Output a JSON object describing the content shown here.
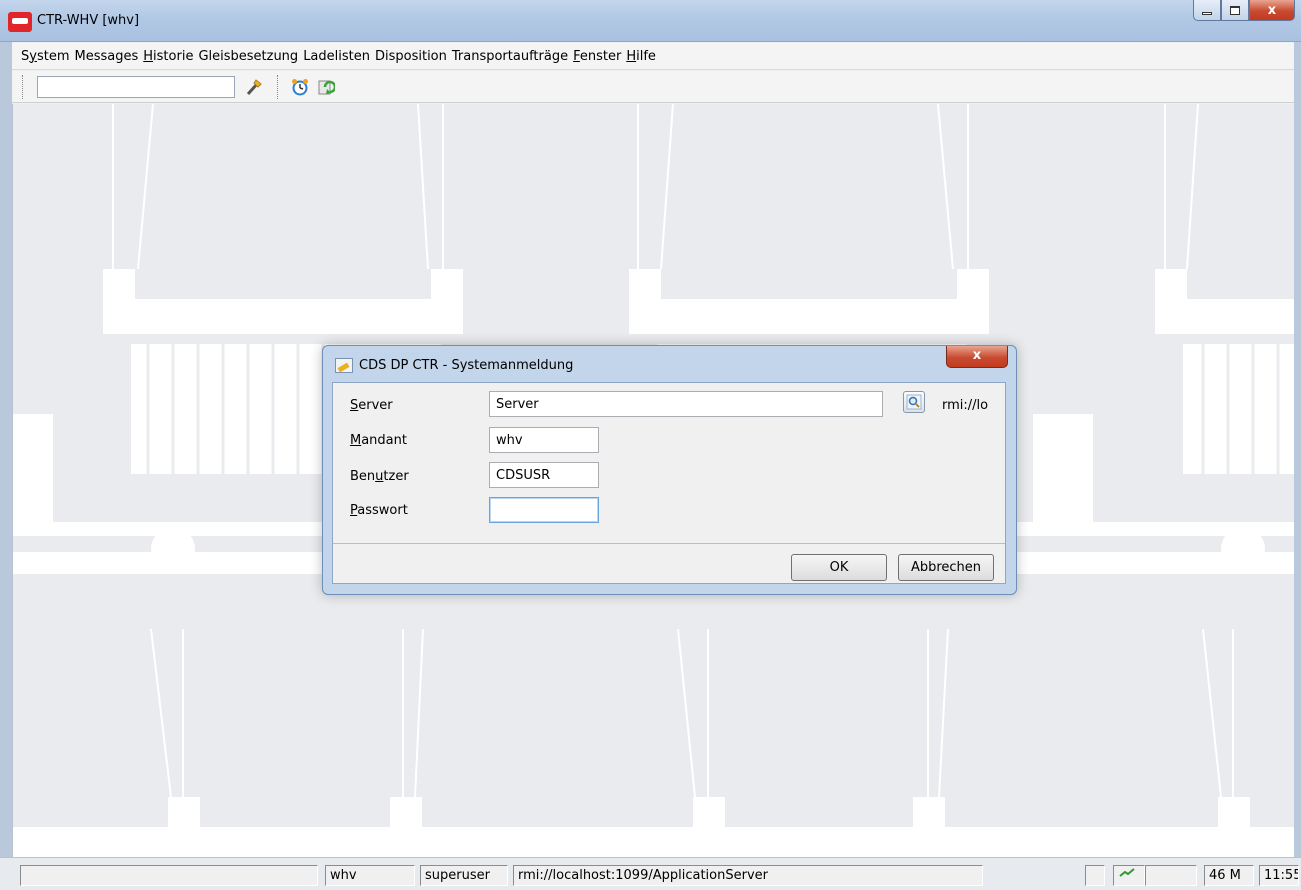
{
  "window": {
    "title": "CTR-WHV  [whv]",
    "close_glyph": "x"
  },
  "menu": {
    "items": [
      {
        "pre": "S",
        "ul": "y",
        "post": "stem"
      },
      {
        "pre": "Messages",
        "ul": "",
        "post": ""
      },
      {
        "pre": "",
        "ul": "H",
        "post": "istorie"
      },
      {
        "pre": "Gleisbesetzung",
        "ul": "",
        "post": ""
      },
      {
        "pre": "Ladelisten",
        "ul": "",
        "post": ""
      },
      {
        "pre": "Disposition",
        "ul": "",
        "post": ""
      },
      {
        "pre": "Transportaufträge",
        "ul": "",
        "post": ""
      },
      {
        "pre": "",
        "ul": "F",
        "post": "enster"
      },
      {
        "pre": "",
        "ul": "H",
        "post": "ilfe"
      }
    ]
  },
  "toolbar": {
    "search_value": "",
    "icons": [
      "wand-icon",
      "alarm-clock-icon",
      "refresh-icon"
    ]
  },
  "dialog": {
    "title": "CDS DP CTR - Systemanmeldung",
    "close_glyph": "x",
    "fields": {
      "server": {
        "label_ul": "S",
        "label_rest": "erver",
        "value": "Server"
      },
      "mandant": {
        "label_ul": "M",
        "label_rest": "andant",
        "value": "whv"
      },
      "benutzer": {
        "label_pre": "Ben",
        "label_ul": "u",
        "label_rest": "tzer",
        "value": "CDSUSR"
      },
      "passwort": {
        "label_ul": "P",
        "label_rest": "asswort",
        "value": ""
      }
    },
    "server_url": "rmi://lo",
    "ok_label": "OK",
    "cancel_label": "Abbrechen"
  },
  "statusbar": {
    "mandant": "whv",
    "user": "superuser",
    "connection": "rmi://localhost:1099/ApplicationServer",
    "memory": "46 M",
    "time": "11:55"
  },
  "colors": {
    "titlebar": "#b6cae5",
    "close_red": "#c84b31",
    "desktop": "#e9ebee"
  }
}
